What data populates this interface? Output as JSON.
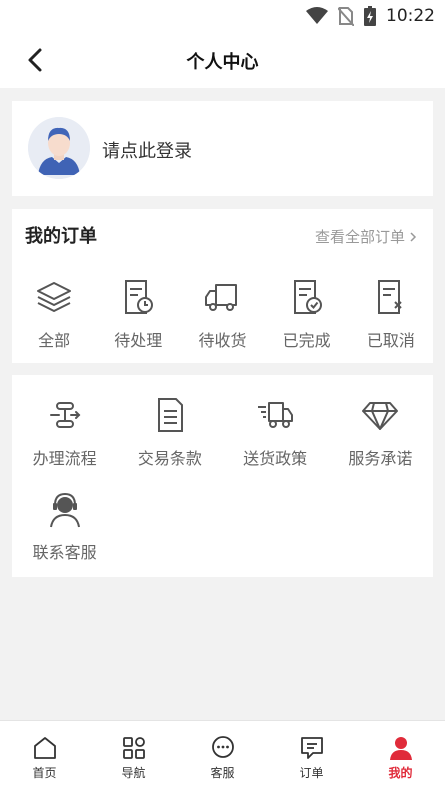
{
  "status_bar": {
    "time": "10:22"
  },
  "header": {
    "title": "个人中心"
  },
  "profile": {
    "login_text": "请点此登录"
  },
  "orders": {
    "title": "我的订单",
    "view_all": "查看全部订单",
    "items": [
      {
        "label": "全部",
        "icon": "layers-icon"
      },
      {
        "label": "待处理",
        "icon": "document-clock-icon"
      },
      {
        "label": "待收货",
        "icon": "truck-icon"
      },
      {
        "label": "已完成",
        "icon": "document-check-icon"
      },
      {
        "label": "已取消",
        "icon": "document-cancel-icon"
      }
    ]
  },
  "services": {
    "items": [
      {
        "label": "办理流程",
        "icon": "flow-icon"
      },
      {
        "label": "交易条款",
        "icon": "document-icon"
      },
      {
        "label": "送货政策",
        "icon": "delivery-truck-icon"
      },
      {
        "label": "服务承诺",
        "icon": "diamond-icon"
      },
      {
        "label": "联系客服",
        "icon": "customer-service-icon"
      }
    ]
  },
  "tabbar": {
    "active_color": "#e02b3a",
    "items": [
      {
        "label": "首页",
        "icon": "home-icon"
      },
      {
        "label": "导航",
        "icon": "grid-icon"
      },
      {
        "label": "客服",
        "icon": "chat-icon"
      },
      {
        "label": "订单",
        "icon": "order-message-icon"
      },
      {
        "label": "我的",
        "icon": "user-icon"
      }
    ]
  }
}
